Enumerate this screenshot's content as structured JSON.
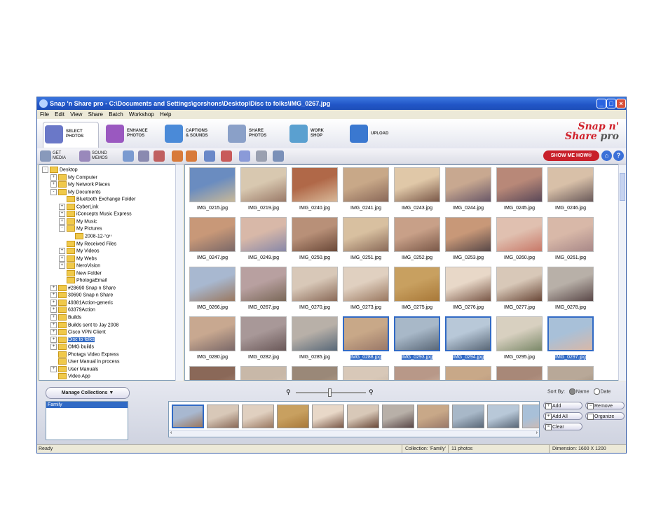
{
  "window": {
    "title": "Snap 'n Share pro - C:\\Documents and Settings\\gorshons\\Desktop\\Disc to folks\\IMG_0267.jpg",
    "controls": [
      "_",
      "□",
      "×"
    ]
  },
  "menu": [
    "File",
    "Edit",
    "View",
    "Share",
    "Batch",
    "Workshop",
    "Help"
  ],
  "tabs": [
    {
      "label": "SELECT\nPHOTOS",
      "icon": "select-photos-icon",
      "color": "#6a78c8"
    },
    {
      "label": "ENHANCE\nPHOTOS",
      "icon": "enhance-photos-icon",
      "color": "#9a58c0"
    },
    {
      "label": "CAPTIONS\n& SOUNDS",
      "icon": "captions-icon",
      "color": "#4a8ad8"
    },
    {
      "label": "SHARE\nPHOTOS",
      "icon": "share-photos-icon",
      "color": "#8aa0c8"
    },
    {
      "label": "WORK\nSHOP",
      "icon": "workshop-icon",
      "color": "#5aa0d0"
    },
    {
      "label": "UPLOAD",
      "icon": "upload-icon",
      "color": "#3a78d0"
    }
  ],
  "logo": {
    "line1": "Snap n'",
    "line2a": "Share",
    "line2b": " pro"
  },
  "toolbar": {
    "get_media": "GET\nMEDIA",
    "sound_memos": "SOUND\nMEMOS",
    "show_me_how": "SHOW ME HOW®",
    "home": "⌂",
    "help": "?"
  },
  "tree": [
    {
      "label": "Desktop",
      "indent": 0,
      "exp": "-"
    },
    {
      "label": "My Computer",
      "indent": 1,
      "exp": "+"
    },
    {
      "label": "My Network Places",
      "indent": 1,
      "exp": "+"
    },
    {
      "label": "My Documents",
      "indent": 1,
      "exp": "-"
    },
    {
      "label": "Bluetooth Exchange Folder",
      "indent": 2,
      "exp": ""
    },
    {
      "label": "CyberLink",
      "indent": 2,
      "exp": "+"
    },
    {
      "label": "iConcepts Music Express",
      "indent": 2,
      "exp": "+"
    },
    {
      "label": "My Music",
      "indent": 2,
      "exp": "+"
    },
    {
      "label": "My Pictures",
      "indent": 2,
      "exp": "-"
    },
    {
      "label": "2008-12-יינר",
      "indent": 3,
      "exp": ""
    },
    {
      "label": "My Received Files",
      "indent": 2,
      "exp": ""
    },
    {
      "label": "My Videos",
      "indent": 2,
      "exp": "+"
    },
    {
      "label": "My Webs",
      "indent": 2,
      "exp": "+"
    },
    {
      "label": "NeroVision",
      "indent": 2,
      "exp": "+"
    },
    {
      "label": "New Folder",
      "indent": 2,
      "exp": ""
    },
    {
      "label": "PhotogaEmail",
      "indent": 2,
      "exp": ""
    },
    {
      "label": "#28690 Snap n Share",
      "indent": 1,
      "exp": "+"
    },
    {
      "label": "30690 Snap n Share",
      "indent": 1,
      "exp": "+"
    },
    {
      "label": "49381Action-generic",
      "indent": 1,
      "exp": "+"
    },
    {
      "label": "63379Action",
      "indent": 1,
      "exp": "+"
    },
    {
      "label": "Builds",
      "indent": 1,
      "exp": "+"
    },
    {
      "label": "Builds sent to Jay 2008",
      "indent": 1,
      "exp": "+"
    },
    {
      "label": "Cisco VPN Client",
      "indent": 1,
      "exp": "+"
    },
    {
      "label": "Disc to folks",
      "indent": 1,
      "exp": "+",
      "selected": true
    },
    {
      "label": "OMG builds",
      "indent": 1,
      "exp": "+"
    },
    {
      "label": "Photags Video Express",
      "indent": 1,
      "exp": ""
    },
    {
      "label": "User Manual in process",
      "indent": 1,
      "exp": ""
    },
    {
      "label": "User Manuals",
      "indent": 1,
      "exp": "+"
    },
    {
      "label": "Video App",
      "indent": 1,
      "exp": ""
    }
  ],
  "photos": [
    {
      "name": "IMG_0215.jpg",
      "colors": [
        "#6a8cc0",
        "#c8b898"
      ]
    },
    {
      "name": "IMG_0219.jpg",
      "colors": [
        "#d8c8b0",
        "#9a7a68"
      ]
    },
    {
      "name": "IMG_0240.jpg",
      "colors": [
        "#b06848",
        "#d8b898"
      ]
    },
    {
      "name": "IMG_0241.jpg",
      "colors": [
        "#c8a888",
        "#8a6858"
      ]
    },
    {
      "name": "IMG_0243.jpg",
      "colors": [
        "#e0c8a8",
        "#7a5848"
      ]
    },
    {
      "name": "IMG_0244.jpg",
      "colors": [
        "#c8a890",
        "#6a5868"
      ]
    },
    {
      "name": "IMG_0245.jpg",
      "colors": [
        "#b88878",
        "#5a4858"
      ]
    },
    {
      "name": "IMG_0246.jpg",
      "colors": [
        "#d8c0a8",
        "#6a5a5a"
      ]
    },
    {
      "name": "IMG_0247.jpg",
      "colors": [
        "#c89878",
        "#7a6868"
      ]
    },
    {
      "name": "IMG_0249.jpg",
      "colors": [
        "#d8b8a8",
        "#8888a8"
      ]
    },
    {
      "name": "IMG_0250.jpg",
      "colors": [
        "#b89078",
        "#6a4838"
      ]
    },
    {
      "name": "IMG_0251.jpg",
      "colors": [
        "#d8c0a0",
        "#8a6a58"
      ]
    },
    {
      "name": "IMG_0252.jpg",
      "colors": [
        "#c8a088",
        "#7a5848"
      ]
    },
    {
      "name": "IMG_0253.jpg",
      "colors": [
        "#c89878",
        "#584848"
      ]
    },
    {
      "name": "IMG_0260.jpg",
      "colors": [
        "#e0c0b0",
        "#c87868"
      ]
    },
    {
      "name": "IMG_0261.jpg",
      "colors": [
        "#d8b8a8",
        "#a88888"
      ]
    },
    {
      "name": "IMG_0266.jpg",
      "colors": [
        "#a8b8d0",
        "#9a7860"
      ]
    },
    {
      "name": "IMG_0267.jpg",
      "colors": [
        "#b8a0a0",
        "#7a6858"
      ]
    },
    {
      "name": "IMG_0270.jpg",
      "colors": [
        "#d8c8b8",
        "#8a6a58"
      ]
    },
    {
      "name": "IMG_0273.jpg",
      "colors": [
        "#e0d0c0",
        "#9a7860"
      ]
    },
    {
      "name": "IMG_0275.jpg",
      "colors": [
        "#c8a060",
        "#a87838"
      ]
    },
    {
      "name": "IMG_0276.jpg",
      "colors": [
        "#e8d8c8",
        "#7a5848"
      ]
    },
    {
      "name": "IMG_0277.jpg",
      "colors": [
        "#d8c8b8",
        "#6a4838"
      ]
    },
    {
      "name": "IMG_0278.jpg",
      "colors": [
        "#b8b0a8",
        "#5a4848"
      ]
    },
    {
      "name": "IMG_0280.jpg",
      "colors": [
        "#c8a890",
        "#7a6868"
      ]
    },
    {
      "name": "IMG_0282.jpg",
      "colors": [
        "#a89898",
        "#6a5858"
      ]
    },
    {
      "name": "IMG_0285.jpg",
      "colors": [
        "#b8b0a8",
        "#586878"
      ]
    },
    {
      "name": "IMG_0288.jpg",
      "colors": [
        "#c8a888",
        "#9a7868"
      ],
      "selected": true
    },
    {
      "name": "IMG_0293.jpg",
      "colors": [
        "#a8b8c8",
        "#5a6878"
      ],
      "selected": true
    },
    {
      "name": "IMG_0294.jpg",
      "colors": [
        "#b8c8d8",
        "#5a6878"
      ],
      "selected": true
    },
    {
      "name": "IMG_0295.jpg",
      "colors": [
        "#d8d0c0",
        "#7a8868"
      ]
    },
    {
      "name": "IMG_0297.jpg",
      "colors": [
        "#a8c0d8",
        "#d8b8a8"
      ],
      "selected": true
    },
    {
      "name": "",
      "colors": [
        "#8a6858",
        "#b89888"
      ]
    },
    {
      "name": "",
      "colors": [
        "#c8b8a8",
        "#d8c8b8"
      ]
    },
    {
      "name": "",
      "colors": [
        "#9a8878",
        "#c8b098"
      ]
    },
    {
      "name": "",
      "colors": [
        "#d8c8b8",
        "#b8a898"
      ]
    },
    {
      "name": "",
      "colors": [
        "#b89888",
        "#d8c8b8"
      ]
    },
    {
      "name": "",
      "colors": [
        "#c8a888",
        "#a88878"
      ]
    },
    {
      "name": "",
      "colors": [
        "#a88878",
        "#c8a898"
      ]
    },
    {
      "name": "",
      "colors": [
        "#b8a898",
        "#887868"
      ]
    }
  ],
  "collections": {
    "manage_label": "Manage Collections",
    "items": [
      "Family"
    ]
  },
  "sort": {
    "label": "Sort By:",
    "name": "Name",
    "date": "Date",
    "selected": "Name"
  },
  "strip": {
    "thumbs": [
      {
        "colors": [
          "#a8b8d0",
          "#9a7860"
        ],
        "selected": true
      },
      {
        "colors": [
          "#d8c8b8",
          "#8a6a58"
        ]
      },
      {
        "colors": [
          "#e0d0c0",
          "#9a7860"
        ]
      },
      {
        "colors": [
          "#c8a060",
          "#a87838"
        ]
      },
      {
        "colors": [
          "#e8d8c8",
          "#7a5848"
        ]
      },
      {
        "colors": [
          "#d8c8b8",
          "#6a4838"
        ]
      },
      {
        "colors": [
          "#b8b0a8",
          "#5a4848"
        ]
      },
      {
        "colors": [
          "#c8a888",
          "#9a7868"
        ]
      },
      {
        "colors": [
          "#a8b8c8",
          "#5a6878"
        ]
      },
      {
        "colors": [
          "#b8c8d8",
          "#5a6878"
        ]
      },
      {
        "colors": [
          "#a8c0d8",
          "#d8b8a8"
        ]
      }
    ],
    "buttons": {
      "add": "Add",
      "remove": "Remove",
      "add_all": "Add All",
      "organize": "Organize",
      "clear": "Clear"
    }
  },
  "status": {
    "left": "Ready",
    "collection": "Collection: 'Family'",
    "count": "11 photos",
    "dimension": "Dimension: 1600 X 1200"
  }
}
